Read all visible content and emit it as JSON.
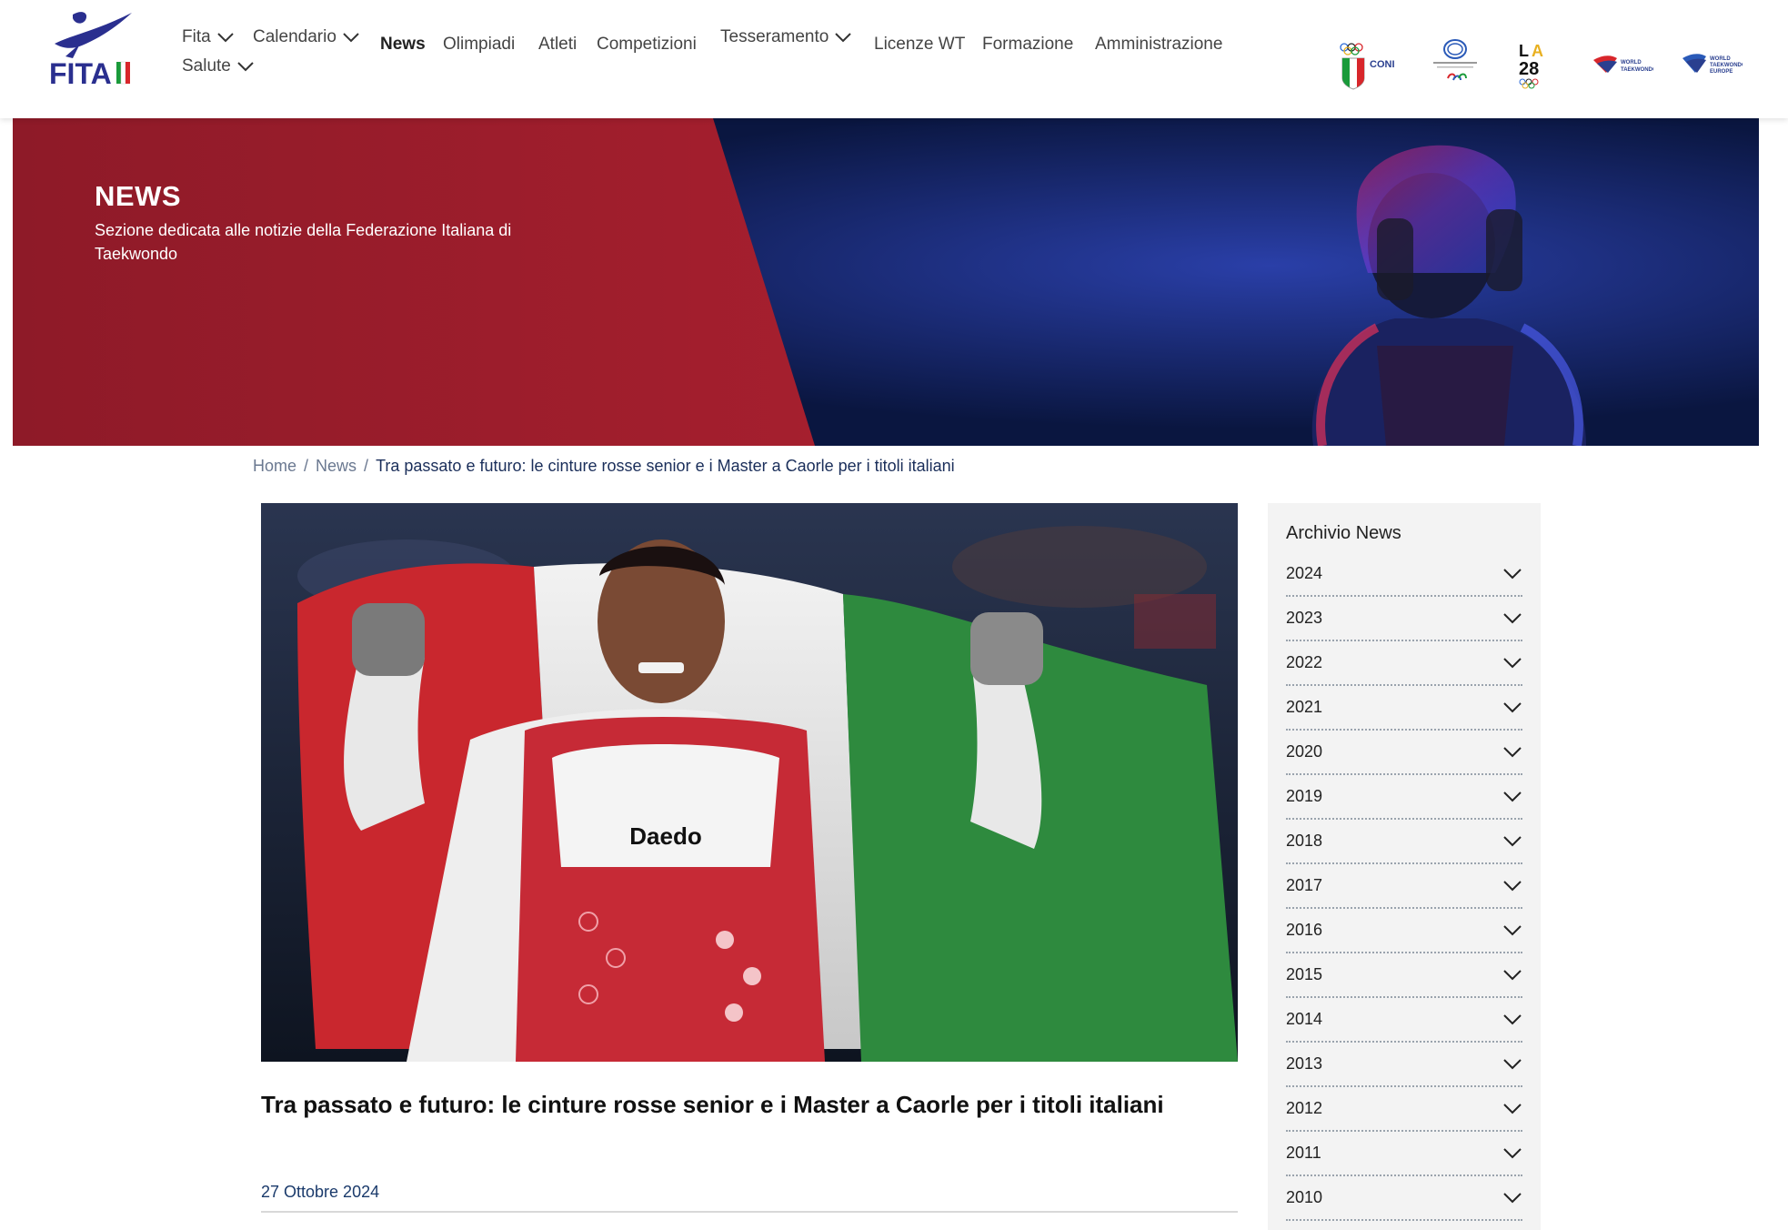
{
  "header": {
    "logo_text": "FITA",
    "nav": [
      {
        "label": "Fita",
        "has_dropdown": true
      },
      {
        "label": "Calendario",
        "has_dropdown": true
      },
      {
        "label": "News",
        "has_dropdown": false,
        "active": true
      },
      {
        "label": "Olimpiadi",
        "has_dropdown": false
      },
      {
        "label": "Atleti",
        "has_dropdown": false
      },
      {
        "label": "Competizioni",
        "has_dropdown": false
      },
      {
        "label": "Tesseramento",
        "has_dropdown": true
      },
      {
        "label": "Licenze WT",
        "has_dropdown": false
      },
      {
        "label": "Formazione",
        "has_dropdown": false
      },
      {
        "label": "Amministrazione",
        "has_dropdown": false
      },
      {
        "label": "Salute",
        "has_dropdown": true
      }
    ],
    "partners": [
      "CONI",
      "Comitato Italiano Paralimpico",
      "LA28",
      "WORLD TAEKWONDO",
      "WORLD TAEKWONDO EUROPE"
    ]
  },
  "hero": {
    "title": "NEWS",
    "subtitle": "Sezione dedicata alle notizie della Federazione Italiana di Taekwondo"
  },
  "breadcrumb": {
    "home": "Home",
    "section": "News",
    "separator": "/",
    "current": "Tra passato e futuro: le cinture rosse senior e i Master a Caorle per i titoli italiani"
  },
  "article": {
    "title": "Tra passato e futuro: le cinture rosse senior e i Master a Caorle per i titoli italiani",
    "date": "27 Ottobre 2024",
    "image_brand": "Daedo"
  },
  "sidebar": {
    "title": "Archivio News",
    "years": [
      "2024",
      "2023",
      "2022",
      "2021",
      "2020",
      "2019",
      "2018",
      "2017",
      "2016",
      "2015",
      "2014",
      "2013",
      "2012",
      "2011",
      "2010"
    ]
  },
  "colors": {
    "brand_blue": "#2a2f8f",
    "hero_red": "#9c1c2b",
    "hero_navy": "#0d1b4a",
    "date_blue": "#1a3a6b"
  }
}
